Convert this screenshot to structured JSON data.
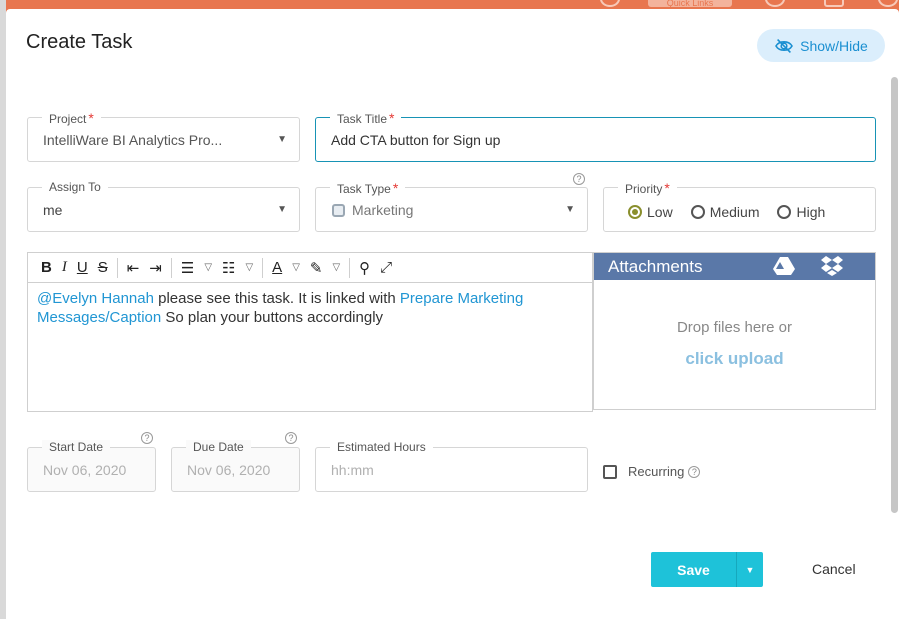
{
  "background": {
    "quick_links": "Quick Links"
  },
  "modal": {
    "title": "Create Task",
    "show_hide_label": "Show/Hide"
  },
  "project": {
    "label": "Project",
    "value": "IntelliWare BI Analytics Pro..."
  },
  "task_title": {
    "label": "Task Title",
    "value": "Add CTA button for Sign up"
  },
  "assign_to": {
    "label": "Assign To",
    "value": "me"
  },
  "task_type": {
    "label": "Task Type",
    "value": "Marketing"
  },
  "priority": {
    "label": "Priority",
    "options": [
      "Low",
      "Medium",
      "High"
    ],
    "selected": "Low"
  },
  "editor": {
    "toolbar": [
      "bold",
      "italic",
      "underline",
      "strikethrough",
      "outdent",
      "indent",
      "ordered-list",
      "unordered-list",
      "font-color",
      "highlight",
      "stamp",
      "fullscreen"
    ],
    "content": {
      "mention": "@Evelyn Hannah",
      "text1": " please see this task. It is linked with ",
      "link": "Prepare Marketing Messages/Caption",
      "text2": " So plan your buttons accordingly"
    }
  },
  "attachments": {
    "title": "Attachments",
    "drop_text": "Drop files here or",
    "upload_text": "click upload"
  },
  "start_date": {
    "label": "Start Date",
    "value": "Nov 06, 2020"
  },
  "due_date": {
    "label": "Due Date",
    "value": "Nov 06, 2020"
  },
  "estimated_hours": {
    "label": "Estimated Hours",
    "placeholder": "hh:mm"
  },
  "recurring": {
    "label": "Recurring",
    "checked": false
  },
  "footer": {
    "save_label": "Save",
    "cancel_label": "Cancel"
  },
  "colors": {
    "accent": "#1ec2d9",
    "header_blue": "#5a78a8",
    "mention": "#2196d3",
    "required": "#e53935"
  }
}
